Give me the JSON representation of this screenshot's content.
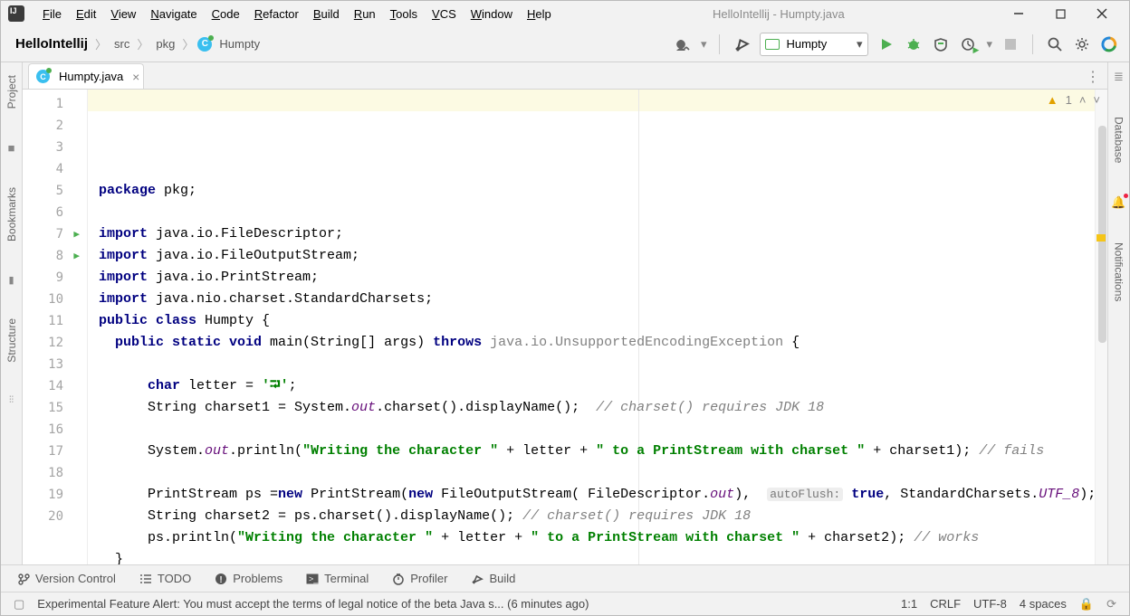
{
  "window": {
    "title": "HelloIntellij - Humpty.java"
  },
  "menu": [
    "File",
    "Edit",
    "View",
    "Navigate",
    "Code",
    "Refactor",
    "Build",
    "Run",
    "Tools",
    "VCS",
    "Window",
    "Help"
  ],
  "breadcrumbs": {
    "root": "HelloIntellij",
    "items": [
      "src",
      "pkg"
    ],
    "class": "Humpty"
  },
  "run_config": "Humpty",
  "tab": {
    "label": "Humpty.java"
  },
  "inspect": {
    "warnings": "1"
  },
  "code": {
    "lines": [
      [
        [
          "kw",
          "package"
        ],
        [
          "",
          " pkg;"
        ]
      ],
      [],
      [
        [
          "kw",
          "import"
        ],
        [
          "",
          " java.io.FileDescriptor;"
        ]
      ],
      [
        [
          "kw",
          "import"
        ],
        [
          "",
          " java.io.FileOutputStream;"
        ]
      ],
      [
        [
          "kw",
          "import"
        ],
        [
          "",
          " java.io.PrintStream;"
        ]
      ],
      [
        [
          "kw",
          "import"
        ],
        [
          "",
          " java.nio.charset.StandardCharsets;"
        ]
      ],
      [
        [
          "kw",
          "public class"
        ],
        [
          "",
          " Humpty {"
        ]
      ],
      [
        [
          "",
          "  "
        ],
        [
          "kw",
          "public static void"
        ],
        [
          "",
          " main(String[] args) "
        ],
        [
          "kw",
          "throws"
        ],
        [
          "",
          " "
        ],
        [
          "exc",
          "java.io.UnsupportedEncodingException"
        ],
        [
          "",
          " {"
        ]
      ],
      [],
      [
        [
          "",
          "      "
        ],
        [
          "kw",
          "char"
        ],
        [
          "",
          " letter = "
        ],
        [
          "str",
          "'⮒'"
        ],
        [
          "",
          ";"
        ]
      ],
      [
        [
          "",
          "      String charset1 = System."
        ],
        [
          "fld",
          "out"
        ],
        [
          "",
          ".charset().displayName();  "
        ],
        [
          "cmt",
          "// charset() requires JDK 18"
        ]
      ],
      [],
      [
        [
          "",
          "      System."
        ],
        [
          "fld",
          "out"
        ],
        [
          "",
          ".println("
        ],
        [
          "str",
          "\"Writing the character \""
        ],
        [
          "",
          " + letter + "
        ],
        [
          "str",
          "\" to a PrintStream with charset \""
        ],
        [
          "",
          " + charset1); "
        ],
        [
          "cmt",
          "// fails"
        ]
      ],
      [],
      [
        [
          "",
          "      PrintStream ps ="
        ],
        [
          "kw",
          "new"
        ],
        [
          "",
          " PrintStream("
        ],
        [
          "kw",
          "new"
        ],
        [
          "",
          " FileOutputStream( FileDescriptor."
        ],
        [
          "fld",
          "out"
        ],
        [
          "",
          ""
        ],
        [
          "",
          ""
        ],
        [
          "",
          "),  "
        ],
        [
          "hint",
          "autoFlush:"
        ],
        [
          "",
          " "
        ],
        [
          "kw",
          "true"
        ],
        [
          "",
          ", StandardCharsets."
        ],
        [
          "fld",
          "UTF_8"
        ],
        [
          "",
          ""
        ],
        [
          "",
          ""
        ],
        [
          "",
          ");"
        ]
      ],
      [
        [
          "",
          "      String charset2 = ps.charset().displayName(); "
        ],
        [
          "cmt",
          "// charset() requires JDK 18"
        ]
      ],
      [
        [
          "",
          "      ps.println("
        ],
        [
          "str",
          "\"Writing the character \""
        ],
        [
          "",
          " + letter + "
        ],
        [
          "str",
          "\" to a PrintStream with charset \""
        ],
        [
          "",
          " + charset2); "
        ],
        [
          "cmt",
          "// works"
        ]
      ],
      [
        [
          "",
          "  }"
        ]
      ],
      [
        [
          "",
          "}"
        ]
      ],
      []
    ],
    "run_gutter": [
      7,
      8
    ]
  },
  "left_tools": [
    {
      "label": "Project",
      "icon": "■"
    },
    {
      "label": "Bookmarks",
      "icon": "★"
    },
    {
      "label": "Structure",
      "icon": "≡"
    }
  ],
  "right_tools": [
    {
      "label": "Database",
      "icon": "≣"
    },
    {
      "label": "Notifications",
      "icon": "●"
    }
  ],
  "bottom_tabs": [
    {
      "label": "Version Control",
      "icon": "branch"
    },
    {
      "label": "TODO",
      "icon": "list"
    },
    {
      "label": "Problems",
      "icon": "warn"
    },
    {
      "label": "Terminal",
      "icon": "term"
    },
    {
      "label": "Profiler",
      "icon": "timer"
    },
    {
      "label": "Build",
      "icon": "hammer"
    }
  ],
  "status": {
    "msg": "Experimental Feature Alert: You must accept the terms of legal notice of the beta Java s... (6 minutes ago)",
    "caret": "1:1",
    "eol": "CRLF",
    "enc": "UTF-8",
    "indent": "4 spaces"
  }
}
